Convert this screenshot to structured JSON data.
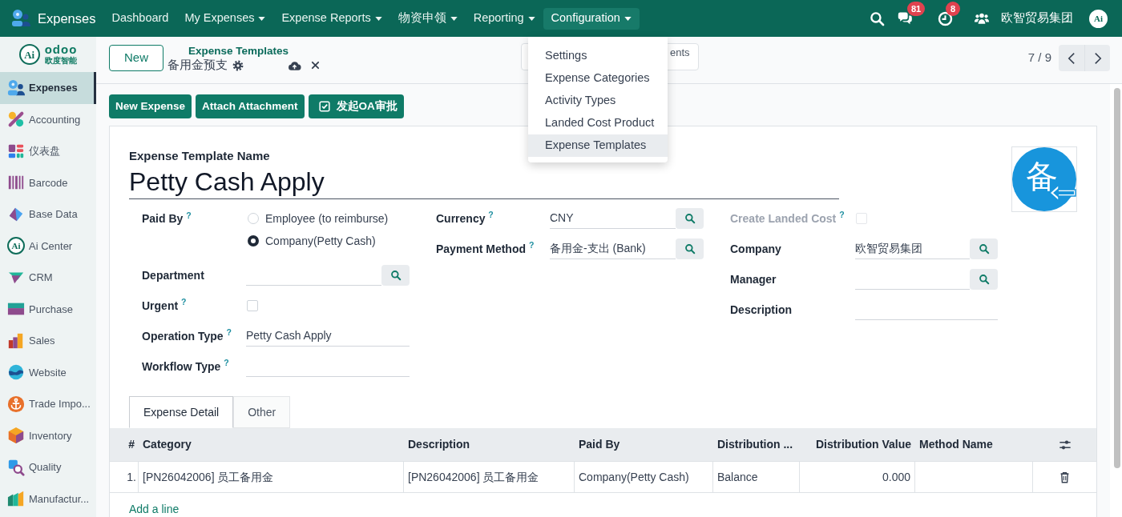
{
  "navbar": {
    "app_name": "Expenses",
    "menus": [
      {
        "label": "Dashboard",
        "dropdown": false,
        "selected": false
      },
      {
        "label": "My Expenses",
        "dropdown": true,
        "selected": false
      },
      {
        "label": "Expense Reports",
        "dropdown": true,
        "selected": false
      },
      {
        "label": "物资申领",
        "dropdown": true,
        "selected": false
      },
      {
        "label": "Reporting",
        "dropdown": true,
        "selected": false
      },
      {
        "label": "Configuration",
        "dropdown": true,
        "selected": true
      }
    ],
    "systray": [
      {
        "kind": "search"
      },
      {
        "kind": "messages",
        "badge": "81"
      },
      {
        "kind": "activities",
        "badge": "8"
      },
      {
        "kind": "users"
      }
    ],
    "company": "欧智贸易集团",
    "avatar": "Ai"
  },
  "dropdown_menu": [
    {
      "label": "Settings",
      "selected": false
    },
    {
      "label": "Expense Categories",
      "selected": false
    },
    {
      "label": "Activity Types",
      "selected": false
    },
    {
      "label": "Landed Cost Product",
      "selected": false
    },
    {
      "label": "Expense Templates",
      "selected": true
    }
  ],
  "sidebar": {
    "logo": {
      "mark": "Ai",
      "name": "odoo",
      "subtitle": "欧度智能"
    },
    "apps": [
      {
        "kind": "expenses",
        "label": "Expenses",
        "selected": true
      },
      {
        "kind": "accounting",
        "label": "Accounting",
        "selected": false
      },
      {
        "kind": "dashboard",
        "label": "仪表盘",
        "selected": false
      },
      {
        "kind": "barcode",
        "label": "Barcode",
        "selected": false
      },
      {
        "kind": "base_data",
        "label": "Base Data",
        "selected": false
      },
      {
        "kind": "ai_center",
        "label": "Ai Center",
        "mark": "Ai",
        "selected": false
      },
      {
        "kind": "crm",
        "label": "CRM",
        "selected": false
      },
      {
        "kind": "purchase",
        "label": "Purchase",
        "selected": false
      },
      {
        "kind": "sales",
        "label": "Sales",
        "selected": false
      },
      {
        "kind": "website",
        "label": "Website",
        "selected": false
      },
      {
        "kind": "trade",
        "label": "Trade Impo...",
        "selected": false
      },
      {
        "kind": "inventory",
        "label": "Inventory",
        "selected": false
      },
      {
        "kind": "quality",
        "label": "Quality",
        "selected": false
      },
      {
        "kind": "manufacturing",
        "label": "Manufactur...",
        "selected": false
      }
    ]
  },
  "control_panel": {
    "new_button": "New",
    "breadcrumb": "Expense Templates",
    "record_name": "备用金预支",
    "covered_button": "ents",
    "pager": "7 / 9"
  },
  "actions": [
    {
      "kind": "plain",
      "label": "New Expense"
    },
    {
      "kind": "plain",
      "label": "Attach Attachment"
    },
    {
      "kind": "approval",
      "label": "发起OA审批"
    }
  ],
  "form": {
    "title_label": "Expense Template Name",
    "title": "Petty Cash Apply",
    "image_text": "备",
    "columns": [
      [
        {
          "kind": "radio",
          "label": "Paid By $^{?}$",
          "options": [
            {
              "label": "Employee (to reimburse)",
              "selected": false
            },
            {
              "label": "Company(Petty Cash)",
              "selected": true
            }
          ]
        },
        {
          "kind": "many2one",
          "label": "Department"
        },
        {
          "kind": "checkbox",
          "label": "Urgent $^{?}$",
          "checked": false,
          "disabled": false
        },
        {
          "kind": "text",
          "label": "Operation Type $^{?}$",
          "value": "Petty Cash Apply"
        },
        {
          "kind": "text",
          "label": "Workflow Type $^{?}$"
        }
      ],
      [
        {
          "kind": "many2one",
          "label": "Currency $^{?}$",
          "value": "CNY"
        },
        {
          "kind": "many2one",
          "label": "Payment Method $^{?}$",
          "value": "备用金-支出 (Bank)"
        }
      ],
      [
        {
          "kind": "checkbox",
          "label": "Create Landed Cost $^{?}$",
          "checked": false,
          "disabled": true
        },
        {
          "kind": "many2one",
          "label": "Company",
          "value": "欧智贸易集团"
        },
        {
          "kind": "many2one",
          "label": "Manager"
        },
        {
          "kind": "text",
          "label": "Description"
        }
      ]
    ]
  },
  "tabs": [
    {
      "label": "Expense Detail",
      "selected": true
    },
    {
      "label": "Other",
      "selected": false
    }
  ],
  "table": {
    "columns": [
      "#",
      "Category",
      "Description",
      "Paid By",
      "Distribution ...",
      "Distribution Value",
      "Method Name"
    ],
    "rows": [
      {
        "cells": [
          "1.",
          "[PN26042006] 员工备用金",
          "[PN26042006] 员工备用金",
          "Company(Petty Cash)",
          "Balance",
          "0.000"
        ]
      }
    ],
    "add_line": "Add a line"
  }
}
